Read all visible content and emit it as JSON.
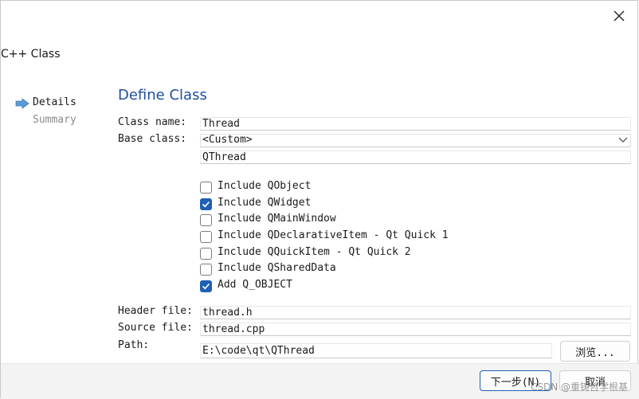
{
  "window": {
    "title": "C++ Class"
  },
  "steps": [
    {
      "label": "Details",
      "active": true
    },
    {
      "label": "Summary",
      "active": false
    }
  ],
  "page": {
    "title": "Define Class"
  },
  "form": {
    "class_name_label": "Class name:",
    "class_name_value": "Thread",
    "base_class_label": "Base class:",
    "base_class_value": "<Custom>",
    "custom_base_value": "QThread",
    "header_file_label": "Header file:",
    "header_file_value": "thread.h",
    "source_file_label": "Source file:",
    "source_file_value": "thread.cpp",
    "path_label": "Path:",
    "path_value": "E:\\code\\qt\\QThread",
    "browse_label": "浏览..."
  },
  "options": [
    {
      "label": "Include QObject",
      "checked": false
    },
    {
      "label": "Include QWidget",
      "checked": true
    },
    {
      "label": "Include QMainWindow",
      "checked": false
    },
    {
      "label": "Include QDeclarativeItem - Qt Quick 1",
      "checked": false
    },
    {
      "label": "Include QQuickItem - Qt Quick 2",
      "checked": false
    },
    {
      "label": "Include QSharedData",
      "checked": false
    },
    {
      "label": "Add Q_OBJECT",
      "checked": true
    }
  ],
  "buttons": {
    "next_label": "下一步(N)",
    "cancel_label": "取消"
  },
  "watermark": "CSDN @重铸哲学根基",
  "colors": {
    "accent": "#1f5fb5",
    "title": "#1f4e9c"
  }
}
